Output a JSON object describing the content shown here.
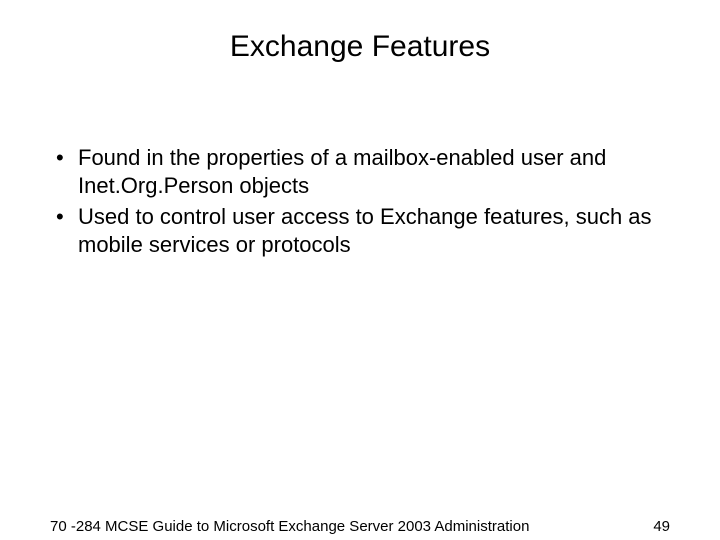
{
  "title": "Exchange Features",
  "bullets": [
    "Found in the properties of a mailbox-enabled user and Inet.Org.Person objects",
    "Used to control user access to Exchange features, such as mobile services or protocols"
  ],
  "footer": {
    "left": "70 -284 MCSE Guide to Microsoft Exchange Server 2003 Administration",
    "page": "49"
  }
}
